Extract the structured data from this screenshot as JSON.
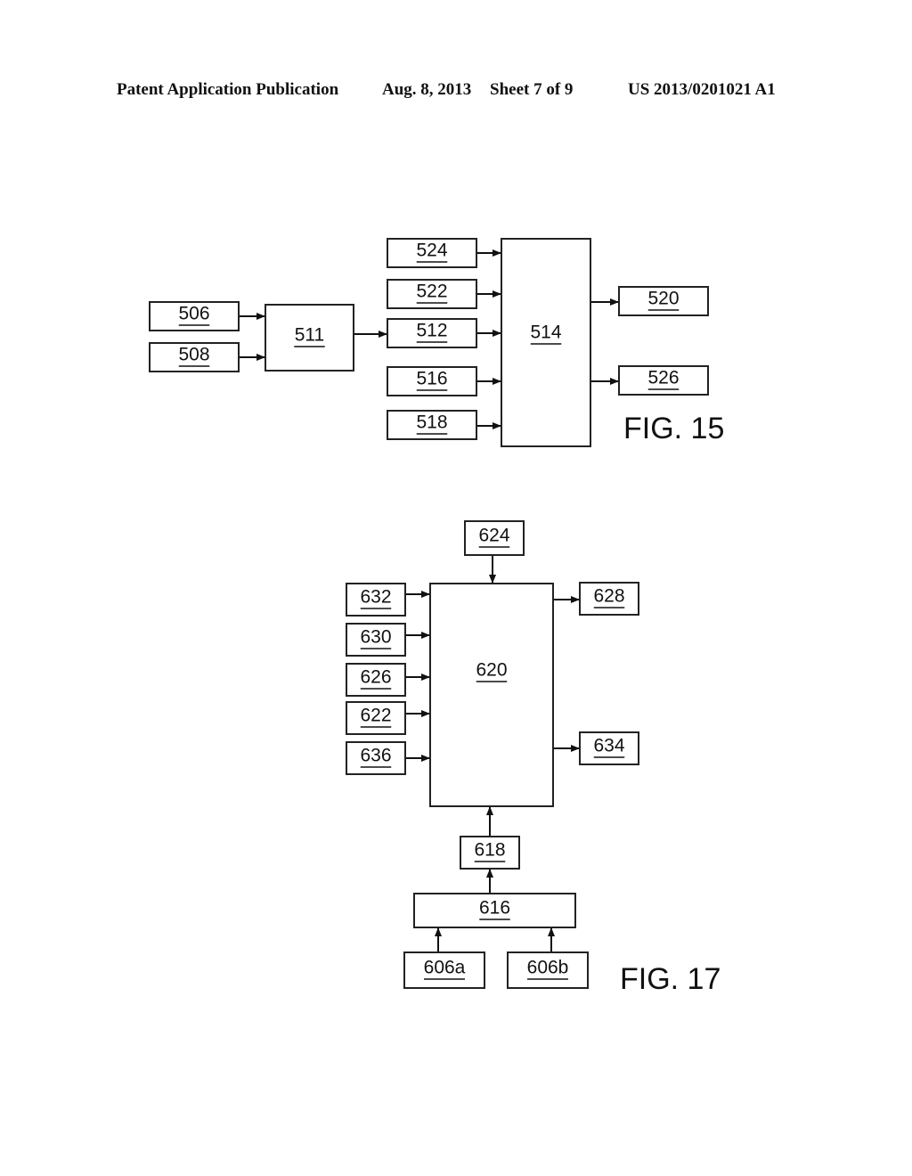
{
  "header": {
    "left": "Patent Application Publication",
    "date": "Aug. 8, 2013",
    "sheet": "Sheet 7 of 9",
    "number": "US 2013/0201021 A1"
  },
  "figures": [
    {
      "id": "fig15",
      "caption": "FIG. 15",
      "blocks": [
        "506",
        "508",
        "511",
        "524",
        "522",
        "512",
        "516",
        "518",
        "514",
        "520",
        "526"
      ],
      "connections": [
        [
          "506",
          "511"
        ],
        [
          "508",
          "511"
        ],
        [
          "511",
          "512"
        ],
        [
          "524",
          "514"
        ],
        [
          "522",
          "514"
        ],
        [
          "512",
          "514"
        ],
        [
          "516",
          "514"
        ],
        [
          "518",
          "514"
        ],
        [
          "514",
          "520"
        ],
        [
          "514",
          "526"
        ]
      ]
    },
    {
      "id": "fig17",
      "caption": "FIG. 17",
      "blocks": [
        "624",
        "620",
        "632",
        "630",
        "626",
        "622",
        "636",
        "628",
        "634",
        "618",
        "616",
        "606a",
        "606b"
      ],
      "connections": [
        [
          "624",
          "620"
        ],
        [
          "632",
          "620"
        ],
        [
          "630",
          "620"
        ],
        [
          "626",
          "620"
        ],
        [
          "622",
          "620"
        ],
        [
          "636",
          "620"
        ],
        [
          "620",
          "628"
        ],
        [
          "620",
          "634"
        ],
        [
          "618",
          "620"
        ],
        [
          "616",
          "618"
        ],
        [
          "606a",
          "616"
        ],
        [
          "606b",
          "616"
        ]
      ]
    }
  ]
}
